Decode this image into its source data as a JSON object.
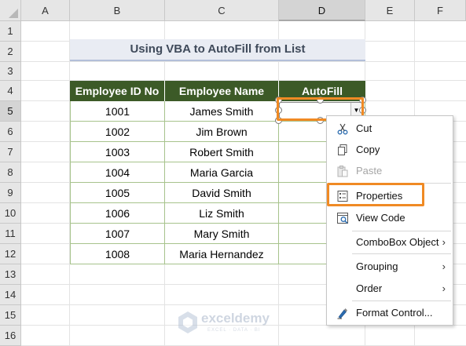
{
  "columns": [
    "A",
    "B",
    "C",
    "D",
    "E",
    "F"
  ],
  "rows": [
    "1",
    "2",
    "3",
    "4",
    "5",
    "6",
    "7",
    "8",
    "9",
    "10",
    "11",
    "12",
    "13",
    "14",
    "15",
    "16"
  ],
  "title": "Using VBA to AutoFill from List",
  "table": {
    "headers": [
      "Employee ID No",
      "Employee Name",
      "AutoFill"
    ],
    "rows": [
      [
        "1001",
        "James Smith"
      ],
      [
        "1002",
        "Jim Brown"
      ],
      [
        "1003",
        "Robert Smith"
      ],
      [
        "1004",
        "Maria Garcia"
      ],
      [
        "1005",
        "David Smith"
      ],
      [
        "1006",
        "Liz Smith"
      ],
      [
        "1007",
        "Mary Smith"
      ],
      [
        "1008",
        "Maria Hernandez"
      ]
    ]
  },
  "menu": {
    "cut": "Cut",
    "copy": "Copy",
    "paste": "Paste",
    "properties": "Properties",
    "view_code": "View Code",
    "combobox_object": "ComboBox Object",
    "grouping": "Grouping",
    "order": "Order",
    "format_control": "Format Control..."
  },
  "watermark": {
    "name": "exceldemy",
    "tagline": "EXCEL · DATA · BI"
  },
  "colors": {
    "header_green": "#3c5a27",
    "highlight_orange": "#f08a24",
    "title_bg": "#e9ecf3"
  }
}
